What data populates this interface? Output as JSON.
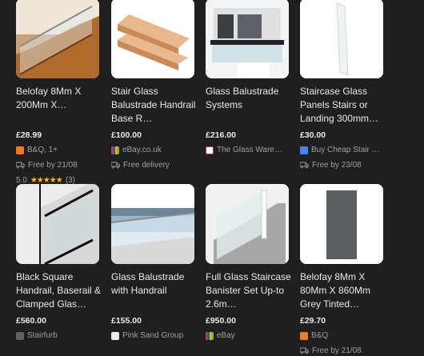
{
  "products": [
    {
      "title": "Belofay 8Mm X 200Mm X…",
      "price": "£28.99",
      "store": "B&Q, 1+",
      "store_icon_color": "#f47920",
      "delivery": "Free by 21/08",
      "rating": "5.0",
      "stars": "★★★★★",
      "reviews": "(3)",
      "image": "glass-staircase-wood-icon"
    },
    {
      "title": "Stair Glass Balustrade Handrail Base R…",
      "price": "£100.00",
      "store": "eBay.co.uk",
      "store_icon_color": "multi",
      "delivery": "Free delivery",
      "image": "wooden-handrail-icon"
    },
    {
      "title": "Glass Balustrade Systems",
      "price": "£216.00",
      "store": "The Glass Ware…",
      "store_icon_color": "#d93025",
      "image": "glass-balcony-icon"
    },
    {
      "title": "Staircase Glass Panels Stairs or Landing 300mm…",
      "price": "£30.00",
      "store": "Buy Cheap Stair …",
      "store_icon_color": "#4285f4",
      "delivery": "Free by 23/08",
      "image": "glass-panel-icon"
    },
    {
      "title": "Black Square Handrail, Baserail & Clamped Glas…",
      "price": "£560.00",
      "store": "Stairfurb",
      "store_icon_color": "#5f6368",
      "image": "black-handrail-stair-icon"
    },
    {
      "title": "Glass Balustrade with Handrail",
      "price": "£155.00",
      "store": "Pink Sand Group",
      "store_icon_color": "#e8eaed",
      "image": "glass-balustrade-terrace-icon"
    },
    {
      "title": "Full Glass Staircase Banister Set Up-to 2.6m…",
      "price": "£950.00",
      "store": "eBay",
      "store_icon_color": "multi",
      "image": "white-staircase-icon"
    },
    {
      "title": "Belofay 8Mm X 80Mm X 860Mm Grey Tinted…",
      "price": "£29.70",
      "store": "B&Q",
      "store_icon_color": "#f47920",
      "delivery": "Free by 21/08",
      "image": "grey-tinted-glass-icon"
    }
  ]
}
